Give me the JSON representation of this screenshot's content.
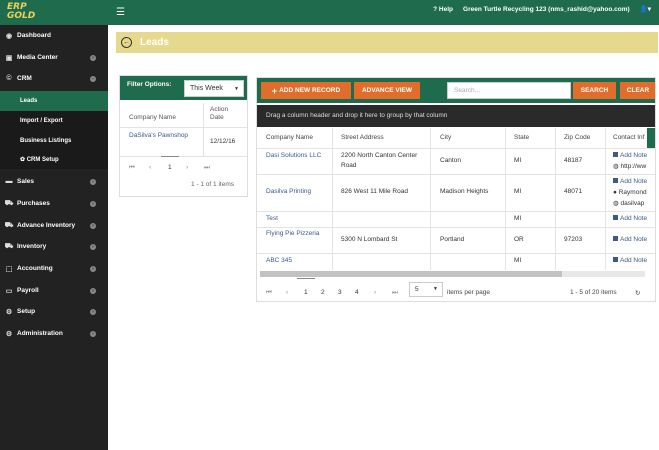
{
  "logo": {
    "line1": "ERP",
    "line2": "GOLD"
  },
  "topbar": {
    "menu_icon": "☰",
    "help": "? Help",
    "company": "Green Turtle Recycling 123 (nms_rashid@yahoo.com)",
    "user_icon": "user-icon"
  },
  "sidebar": {
    "items": [
      {
        "label": "Dashboard",
        "icon": "dashboard-icon"
      },
      {
        "label": "Media Center",
        "icon": "media-icon"
      },
      {
        "label": "CRM",
        "icon": "crm-icon"
      },
      {
        "label": "Sales",
        "icon": "sales-icon"
      },
      {
        "label": "Purchases",
        "icon": "purchases-icon"
      },
      {
        "label": "Advance Inventory",
        "icon": "advance-inventory-icon"
      },
      {
        "label": "Inventory",
        "icon": "inventory-icon"
      },
      {
        "label": "Accounting",
        "icon": "accounting-icon"
      },
      {
        "label": "Payroll",
        "icon": "payroll-icon"
      },
      {
        "label": "Setup",
        "icon": "setup-icon"
      },
      {
        "label": "Administration",
        "icon": "administration-icon"
      }
    ],
    "crm_sub": [
      "Leads",
      "Import / Export",
      "Business Listings",
      "✿ CRM Setup"
    ]
  },
  "page": {
    "title": "Leads"
  },
  "filter": {
    "label": "Filter Options:",
    "selected": "This Week",
    "columns": [
      "Company Name",
      "Action Date"
    ],
    "rows": [
      {
        "company": "DaSilva's Pawnshop",
        "date": "12/12/16"
      }
    ],
    "page": "1",
    "summary": "1 - 1 of 1 items"
  },
  "toolbar": {
    "add_label": "ADD NEW RECORD",
    "advance_label": "ADVANCE VIEW",
    "search_placeholder": "Search...",
    "search_label": "SEARCH",
    "clear_label": "CLEAR"
  },
  "grid": {
    "group_hint": "Drag a column header and drop it here to group by that column",
    "columns": [
      "Company Name",
      "Street Address",
      "City",
      "State",
      "Zip Code",
      "Contact Inf"
    ],
    "rows": [
      {
        "company": "Dasi Solutions LLC",
        "street": "2200 North Canton Center Road",
        "city": "Canton",
        "state": "MI",
        "zip": "48187",
        "contact": [
          "Add Note",
          "http://ww"
        ]
      },
      {
        "company": "Dasilva Printing",
        "street": "826 West 11 Mile Road",
        "city": "Madison Heights",
        "state": "MI",
        "zip": "48071",
        "contact": [
          "Add Note",
          "Raymond",
          "dasilvap"
        ]
      },
      {
        "company": "Test",
        "street": "",
        "city": "",
        "state": "MI",
        "zip": "",
        "contact": [
          "Add Note"
        ]
      },
      {
        "company": "Flying Pie Pizzeria",
        "street": "5300 N Lombard St",
        "city": "Portland",
        "state": "OR",
        "zip": "97203",
        "contact": [
          "Add Note"
        ]
      },
      {
        "company": "ABC 345",
        "street": "",
        "city": "",
        "state": "MI",
        "zip": "",
        "contact": [
          "Add Note"
        ]
      }
    ],
    "pages": [
      "1",
      "2",
      "3",
      "4"
    ],
    "page_size": "5",
    "items_per_page": "items per page",
    "summary": "1 - 5 of 20 items"
  }
}
